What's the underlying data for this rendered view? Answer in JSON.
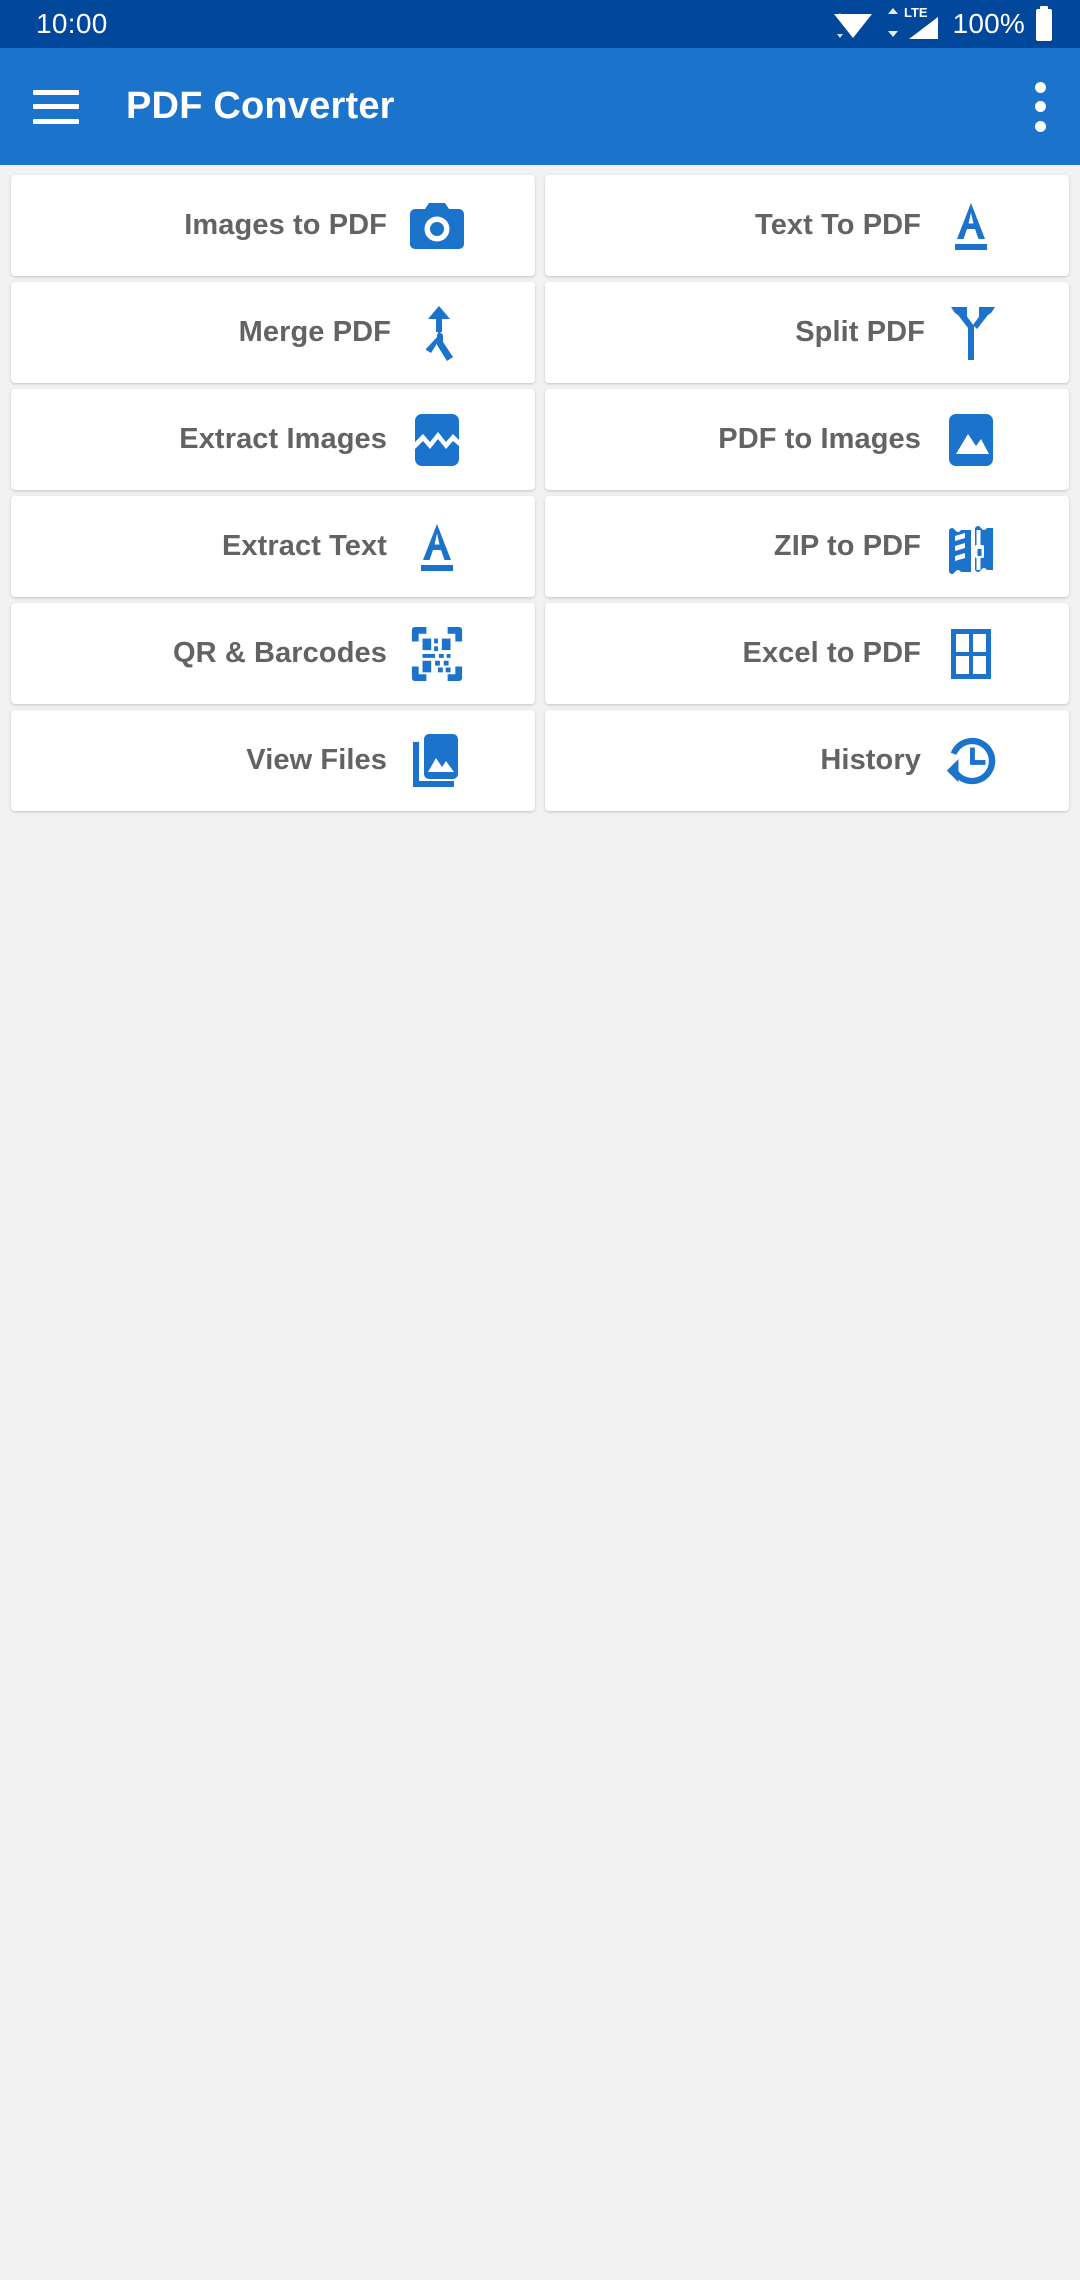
{
  "status_bar": {
    "clock": "10:00",
    "battery_text": "100%",
    "network_type": "LTE",
    "icons": [
      "wifi-icon",
      "cellular-signal-icon",
      "battery-icon"
    ],
    "background_color": "#01479B"
  },
  "app_bar": {
    "title": "PDF Converter",
    "menu_icon": "hamburger-menu-icon",
    "overflow_icon": "overflow-menu-icon",
    "background_color": "#1B73CB"
  },
  "theme": {
    "accent_color": "#1B73CB",
    "page_background": "#F2F2F2",
    "card_background": "#FFFFFF",
    "label_color": "#636363"
  },
  "grid": {
    "items": [
      {
        "label": "Images to PDF",
        "icon": "camera-icon"
      },
      {
        "label": "Text To PDF",
        "icon": "format-underlined-a-icon"
      },
      {
        "label": "Merge PDF",
        "icon": "call-merge-icon"
      },
      {
        "label": "Split PDF",
        "icon": "call-split-icon"
      },
      {
        "label": "Extract Images",
        "icon": "broken-image-icon"
      },
      {
        "label": "PDF to Images",
        "icon": "photo-icon"
      },
      {
        "label": "Extract Text",
        "icon": "format-underlined-a-icon"
      },
      {
        "label": "ZIP to PDF",
        "icon": "zip-archive-icon"
      },
      {
        "label": "QR & Barcodes",
        "icon": "qr-code-scanner-icon"
      },
      {
        "label": "Excel to PDF",
        "icon": "table-grid-icon"
      },
      {
        "label": "View Files",
        "icon": "photo-library-icon"
      },
      {
        "label": "History",
        "icon": "history-clock-icon"
      }
    ]
  }
}
